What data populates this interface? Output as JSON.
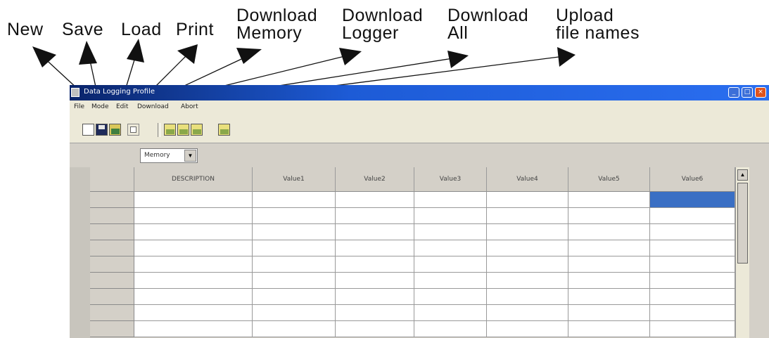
{
  "callouts": [
    {
      "text": "New"
    },
    {
      "text": "Save"
    },
    {
      "text": "Load"
    },
    {
      "text": "Print"
    },
    {
      "text": "Download Memory",
      "line1": "Download",
      "line2": "Memory"
    },
    {
      "text": "Download Logger",
      "line1": "Download",
      "line2": "Logger"
    },
    {
      "text": "Download All",
      "line1": "Download",
      "line2": "All"
    },
    {
      "text": "Upload file names",
      "line1": "Upload",
      "line2": "file names"
    }
  ],
  "window": {
    "title": "Data Logging Profile",
    "menu": [
      "File",
      "Mode",
      "Edit",
      "Download",
      "Abort"
    ],
    "toolbar_icons": [
      "new-icon",
      "save-icon",
      "load-icon",
      "print-icon",
      "download-memory-icon",
      "download-logger-icon",
      "download-all-icon",
      "upload-file-names-icon"
    ]
  },
  "filter": {
    "selected": "Memory"
  },
  "table": {
    "columns": [
      "DESCRIPTION",
      "Value1",
      "Value2",
      "Value3",
      "Value4",
      "Value5",
      "Value6"
    ],
    "visible_rows": 9,
    "selected_cell": {
      "row": 0,
      "column": "Value6"
    }
  },
  "colors": {
    "titlebar": "#0a246a",
    "selected_cell": "#3a6fc4",
    "window_bg": "#d4d0c8"
  }
}
